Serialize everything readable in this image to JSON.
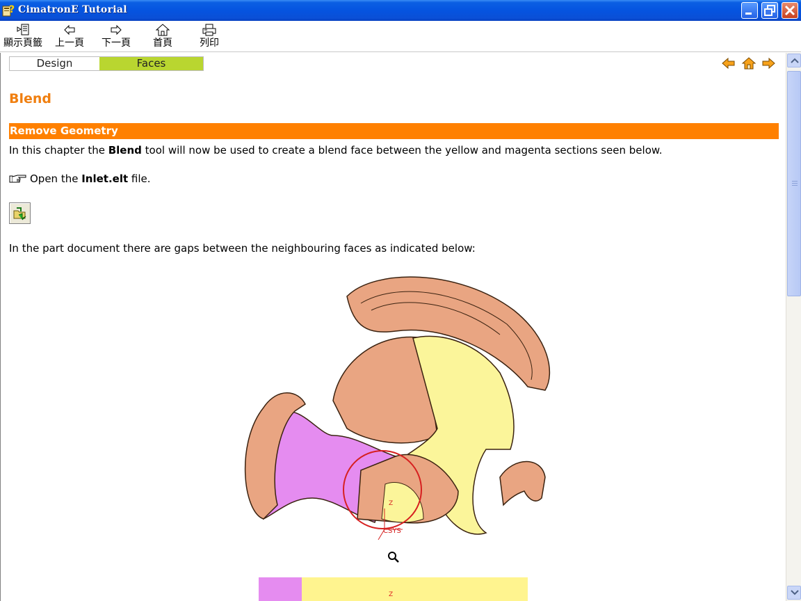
{
  "window": {
    "title": "CimatronE Tutorial",
    "app_icon": "help-book-icon",
    "controls": [
      "minimize-icon",
      "maximize-icon",
      "close-icon"
    ]
  },
  "toolbar": {
    "bookmark_label": "顯示頁籤",
    "prev_label": "上一頁",
    "next_label": "下一頁",
    "home_label": "首頁",
    "print_label": "列印"
  },
  "tabs": [
    {
      "label": "Design",
      "active": false
    },
    {
      "label": "Faces",
      "active": true,
      "color": "#b9d630"
    }
  ],
  "nav_icons": [
    "arrow-left-icon",
    "home-icon",
    "arrow-right-icon"
  ],
  "page": {
    "title": "Blend",
    "title_color": "#f07f10",
    "section_title": "Remove Geometry",
    "section_color": "#ff8000",
    "p1_pre": "In this chapter the ",
    "p1_bold": "Blend",
    "p1_post": " tool will now be used to create a blend face between the yellow and magenta sections seen below.",
    "p2_pre": "Open the ",
    "p2_bold": "Inlet.elt",
    "p2_post": " file.",
    "p3": "In the part document there are gaps between the neighbouring faces as indicated below:",
    "figure_annotations": {
      "axis_label": "CSYS",
      "z_label": "Z"
    },
    "preview_z_label": "Z"
  }
}
